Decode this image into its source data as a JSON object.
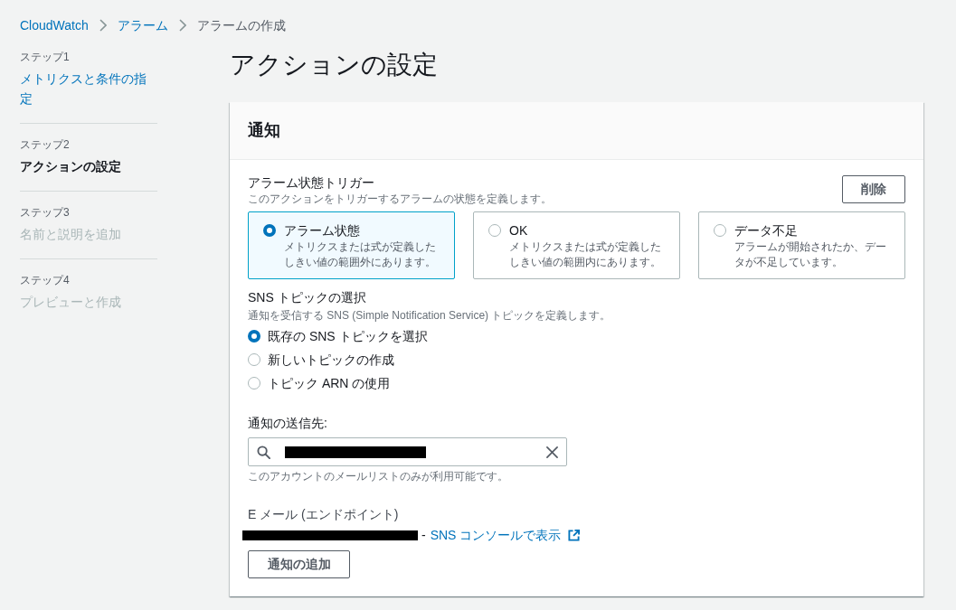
{
  "breadcrumb": [
    {
      "label": "CloudWatch",
      "kind": "link"
    },
    {
      "label": "アラーム",
      "kind": "link"
    },
    {
      "label": "アラームの作成",
      "kind": "current"
    }
  ],
  "steps": [
    {
      "step": "ステップ1",
      "title": "メトリクスと条件の指定",
      "selected": false,
      "disabled": false
    },
    {
      "step": "ステップ2",
      "title": "アクションの設定",
      "selected": true,
      "disabled": false
    },
    {
      "step": "ステップ3",
      "title": "名前と説明を追加",
      "selected": false,
      "disabled": true
    },
    {
      "step": "ステップ4",
      "title": "プレビューと作成",
      "selected": false,
      "disabled": true
    }
  ],
  "page_title": "アクションの設定",
  "notification": {
    "title": "通知",
    "trigger": {
      "label": "アラーム状態トリガー",
      "description": "このアクションをトリガーするアラームの状態を定義します。",
      "remove_button": "削除",
      "options": [
        {
          "label": "アラーム状態",
          "description": "メトリクスまたは式が定義したしきい値の範囲外にあります。",
          "selected": true
        },
        {
          "label": "OK",
          "description": "メトリクスまたは式が定義したしきい値の範囲内にあります。",
          "selected": false
        },
        {
          "label": "データ不足",
          "description": "アラームが開始されたか、データが不足しています。",
          "selected": false
        }
      ]
    },
    "topic": {
      "label": "SNS トピックの選択",
      "description": "通知を受信する SNS (Simple Notification Service) トピックを定義します。",
      "options": [
        {
          "label": "既存の SNS トピックを選択",
          "selected": true
        },
        {
          "label": "新しいトピックの作成",
          "selected": false
        },
        {
          "label": "トピック ARN の使用",
          "selected": false
        }
      ]
    },
    "recipient": {
      "label": "通知の送信先:",
      "value_redacted": true,
      "hint": "このアカウントのメールリストのみが利用可能です。"
    },
    "endpoint": {
      "label": "E メール (エンドポイント)",
      "value_redacted": true,
      "separator": "-",
      "link": "SNS コンソールで表示"
    },
    "add_button": "通知の追加"
  }
}
